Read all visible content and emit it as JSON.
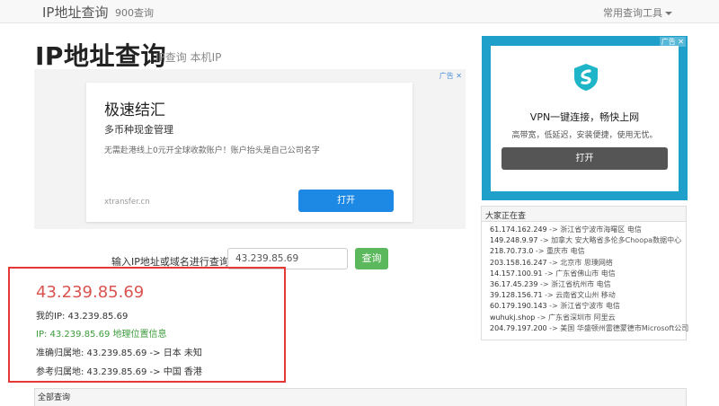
{
  "navbar": {
    "brand": "IP地址查询",
    "link": "900查询",
    "tools_label": "常用查询工具"
  },
  "heading": {
    "title": "IP地址查询",
    "subtitle": "IP查询 本机IP"
  },
  "ad_left": {
    "ad_mark": "广告 ✕",
    "headline": "极速结汇",
    "subheadline": "多币种现金管理",
    "description": "无需赴港线上0元开全球收款账户！账户抬头是自己公司名字",
    "domain": "xtransfer.cn",
    "button": "打开"
  },
  "ad_right": {
    "ad_mark": "广告 ✕",
    "title": "VPN一键连接，畅快上网",
    "description": "高带宽，低延迟，安装便捷，使用无忧。",
    "button": "打开"
  },
  "recent": {
    "header": "大家正在查",
    "items": [
      {
        "ip": "61.174.162.249",
        "loc": " -> 浙江省宁波市海曙区 电信"
      },
      {
        "ip": "149.248.9.97",
        "loc": " -> 加拿大 安大略省多伦多Choopa数据中心"
      },
      {
        "ip": "218.70.73.0",
        "loc": " -> 重庆市 电信"
      },
      {
        "ip": "203.158.16.247",
        "loc": " -> 北京市 思璞网络"
      },
      {
        "ip": "14.157.100.91",
        "loc": " -> 广东省佛山市 电信"
      },
      {
        "ip": "36.17.45.239",
        "loc": " -> 浙江省杭州市 电信"
      },
      {
        "ip": "39.128.156.71",
        "loc": " -> 云南省文山州 移动"
      },
      {
        "ip": "60.179.190.143",
        "loc": " -> 浙江省宁波市 电信"
      },
      {
        "ip": "wuhukj.shop",
        "loc": " -> 广东省深圳市 阿里云"
      },
      {
        "ip": "204.79.197.200",
        "loc": " -> 美国 华盛顿州雷德蒙德市Microsoft公司"
      }
    ]
  },
  "query": {
    "label": "输入IP地址或域名进行查询",
    "input_value": "43.239.85.69",
    "button": "查询"
  },
  "result": {
    "ip": "43.239.85.69",
    "my_ip": "我的IP: 43.239.85.69",
    "geo_link": "IP: 43.239.85.69 地理位置信息",
    "accurate": "准确归属地: 43.239.85.69 -> 日本 未知",
    "reference": "参考归属地: 43.239.85.69 -> 中国 香港"
  },
  "bottom": {
    "label": "全部查询"
  },
  "colors": {
    "result_border": "#e53935",
    "result_ip": "#d9534f",
    "query_button": "#5cb85c",
    "ad_button": "#1e88e5",
    "ad_right_bg": "#1fa0ca"
  }
}
